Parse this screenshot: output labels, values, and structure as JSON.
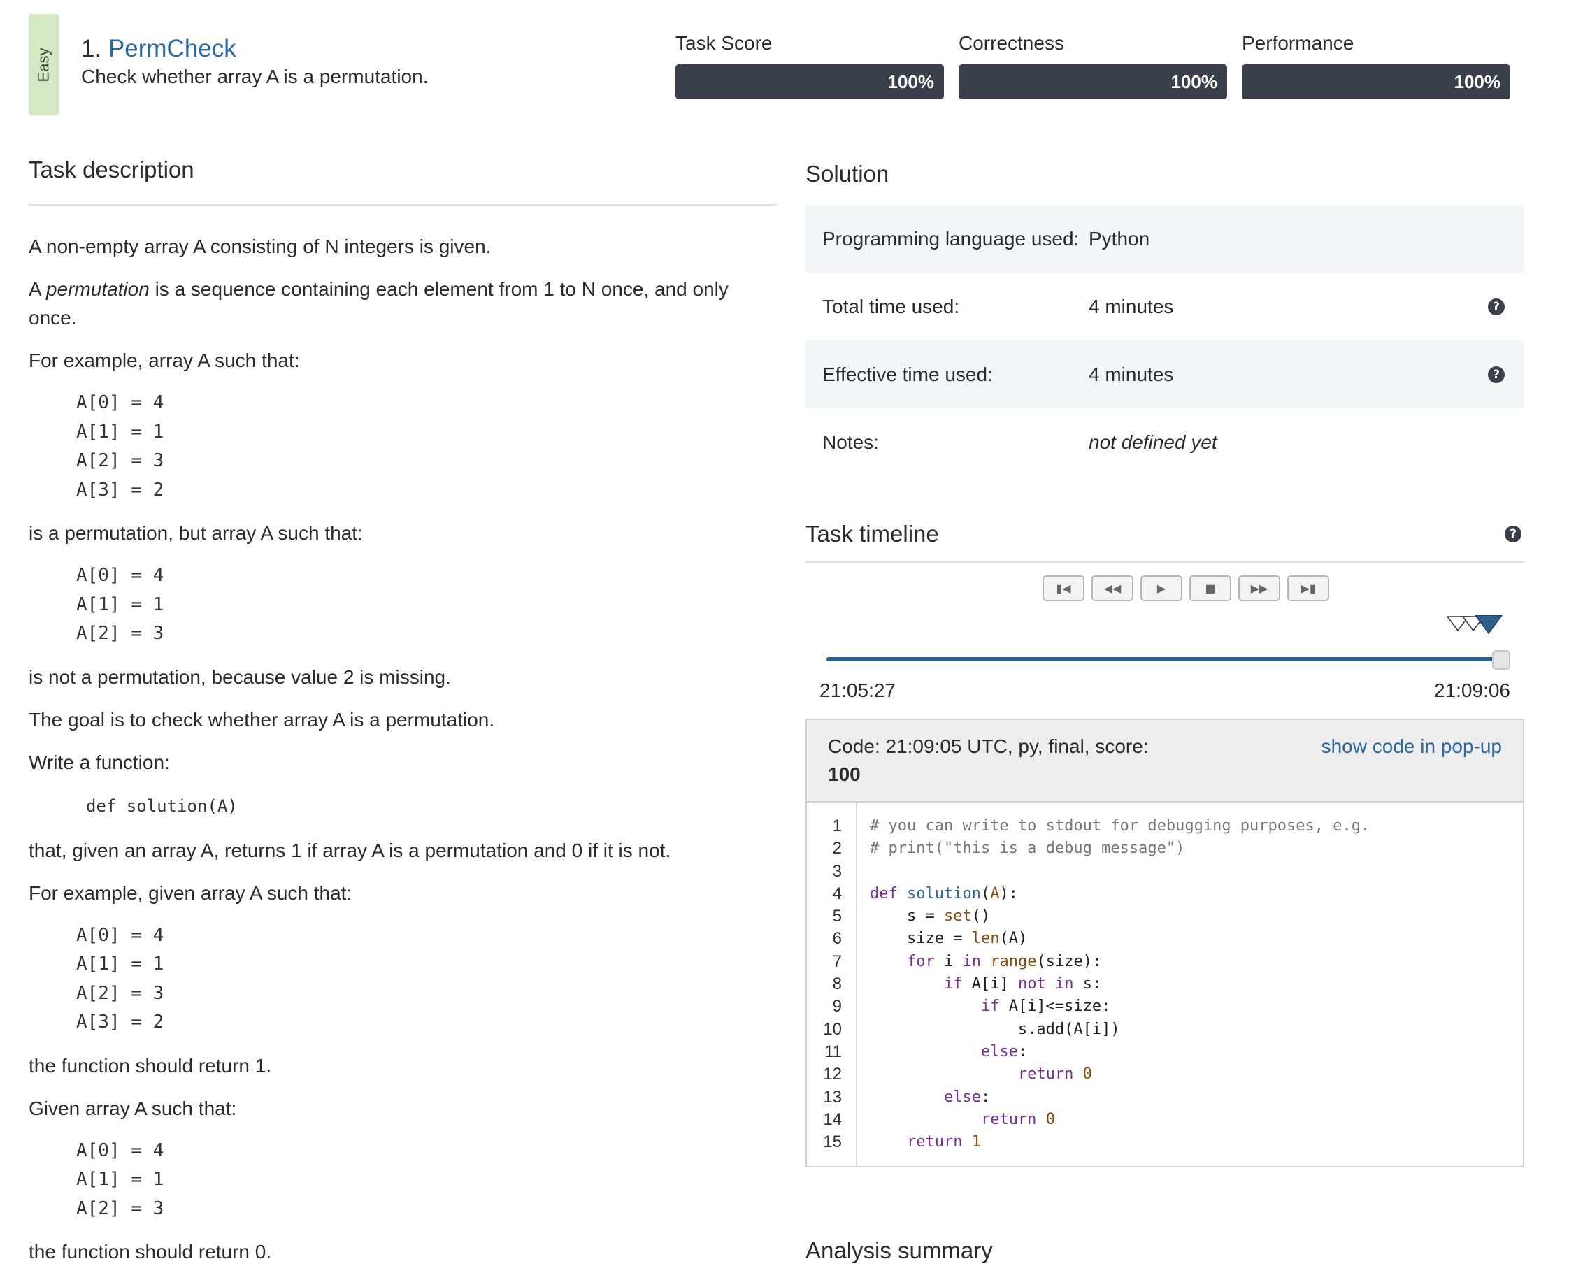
{
  "header": {
    "difficulty": "Easy",
    "task_number": "1.",
    "task_name": "PermCheck",
    "task_summary": "Check whether array A is a permutation.",
    "scores": [
      {
        "label": "Task Score",
        "value": "100%",
        "fraction": 1.0
      },
      {
        "label": "Correctness",
        "value": "100%",
        "fraction": 1.0
      },
      {
        "label": "Performance",
        "value": "100%",
        "fraction": 1.0
      }
    ]
  },
  "description": {
    "title": "Task description",
    "p1": "A non-empty array A consisting of N integers is given.",
    "p2_pre": "A ",
    "p2_em": "permutation",
    "p2_post": " is a sequence containing each element from 1 to N once, and only once.",
    "p3": "For example, array A such that:",
    "ex1": "A[0] = 4\nA[1] = 1\nA[2] = 3\nA[3] = 2",
    "p4": "is a permutation, but array A such that:",
    "ex2": "A[0] = 4\nA[1] = 1\nA[2] = 3",
    "p5": "is not a permutation, because value 2 is missing.",
    "p6": "The goal is to check whether array A is a permutation.",
    "p7": "Write a function:",
    "signature": "def solution(A)",
    "p8": "that, given an array A, returns 1 if array A is a permutation and 0 if it is not.",
    "p9": "For example, given array A such that:",
    "ex3": "A[0] = 4\nA[1] = 1\nA[2] = 3\nA[3] = 2",
    "p10": "the function should return 1.",
    "p11": "Given array A such that:",
    "ex4": "A[0] = 4\nA[1] = 1\nA[2] = 3",
    "p12": "the function should return 0."
  },
  "solution": {
    "title": "Solution",
    "rows": [
      {
        "key": "Programming language used:",
        "value": "Python"
      },
      {
        "key": "Total time used:",
        "value": "4 minutes",
        "help": "?"
      },
      {
        "key": "Effective time used:",
        "value": "4 minutes",
        "help": "?"
      },
      {
        "key": "Notes:",
        "value": "not defined yet"
      }
    ]
  },
  "timeline": {
    "title": "Task timeline",
    "help": "?",
    "start_time": "21:05:27",
    "end_time": "21:09:06",
    "position": 1.0,
    "controls": [
      "first",
      "rewind",
      "play",
      "stop",
      "fast-forward",
      "last"
    ]
  },
  "code": {
    "header_meta": "Code: 21:09:05 UTC, py, final, score:",
    "header_score": "100",
    "popup_link": "show code in pop-up",
    "line_numbers": [
      "1",
      "2",
      "3",
      "4",
      "5",
      "6",
      "7",
      "8",
      "9",
      "10",
      "11",
      "12",
      "13",
      "14",
      "15"
    ]
  },
  "analysis": {
    "title": "Analysis summary"
  },
  "colors": {
    "difficulty_bg": "#d4e8c3",
    "score_bar": "#3b3f4a",
    "link": "#2a6aa3",
    "timeline_track": "#2d5f8d"
  }
}
